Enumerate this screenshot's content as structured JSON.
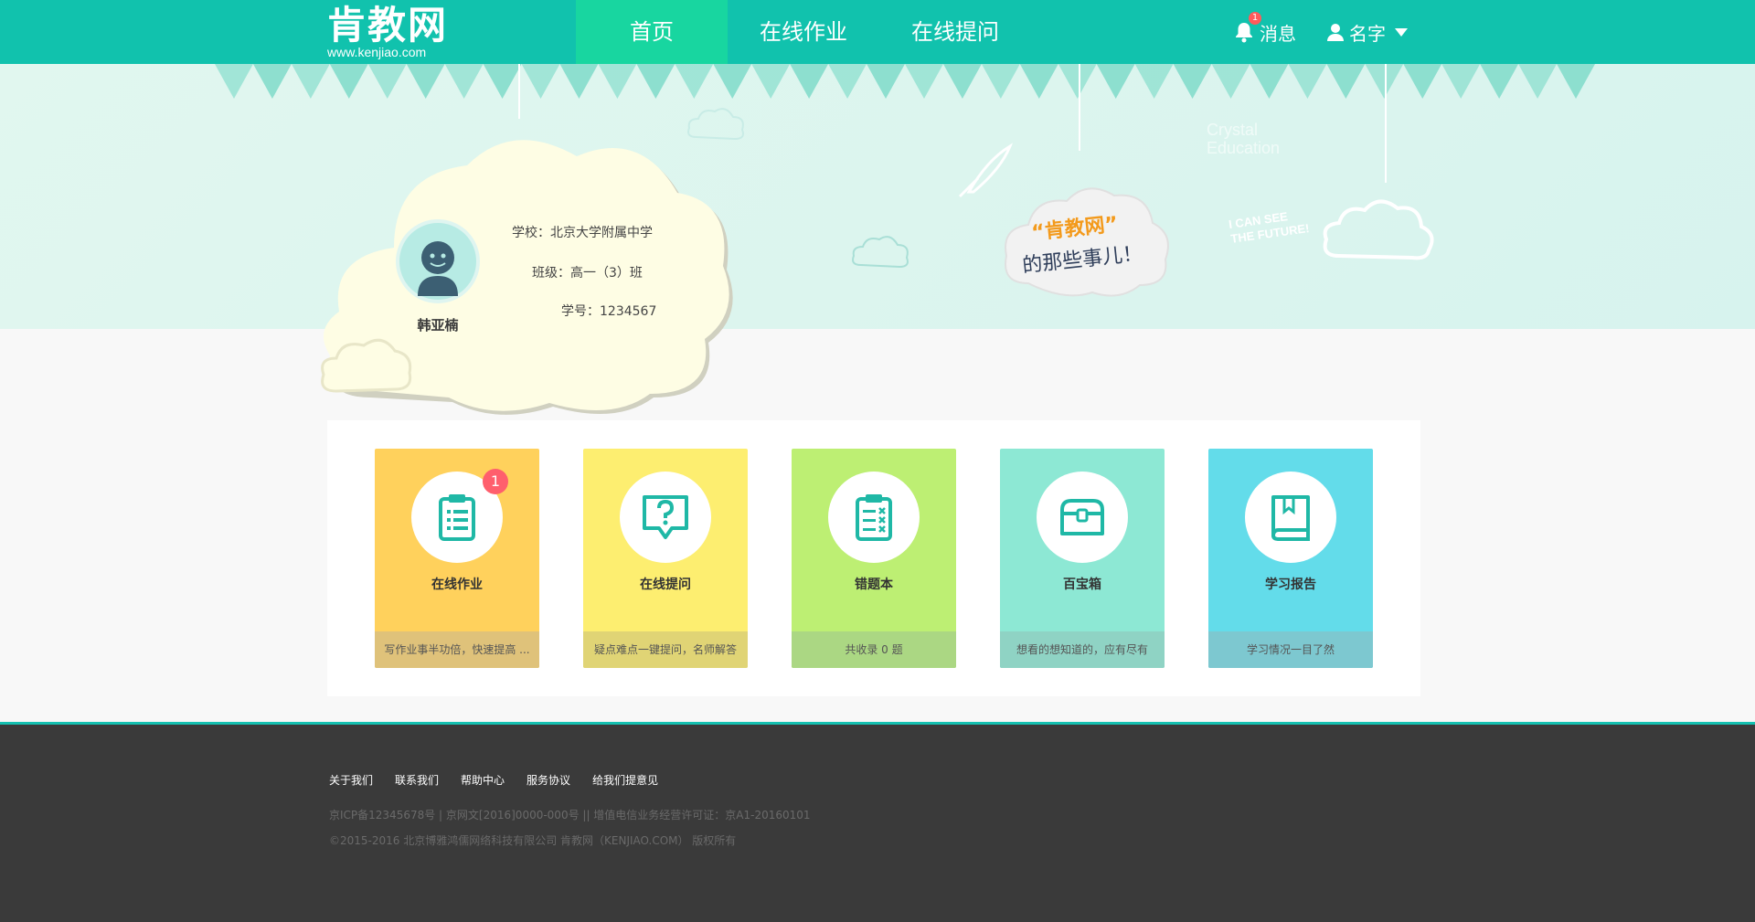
{
  "header": {
    "logo_text": "肯教网",
    "logo_domain": "www.kenjiao.com",
    "nav": [
      {
        "label": "首页",
        "active": true
      },
      {
        "label": "在线作业",
        "active": false
      },
      {
        "label": "在线提问",
        "active": false
      }
    ],
    "messages_label": "消息",
    "messages_badge": "1",
    "user_name": "名字"
  },
  "banner": {
    "slogan_brand": "“肯教网”",
    "slogan_tail": "的那些事儿！",
    "crystal_line1": "Crystal",
    "crystal_line2": "Education",
    "future_line1": "I CAN SEE",
    "future_line2": "THE FUTURE!"
  },
  "profile": {
    "name": "韩亚楠",
    "school": "学校：北京大学附属中学",
    "class": "班级：高一（3）班",
    "student_no": "学号：1234567"
  },
  "cards": [
    {
      "title": "在线作业",
      "desc": "写作业事半功倍，快速提高 ...",
      "badge": "1",
      "color": "#ffd15c",
      "foot": "#dfc27a",
      "icon": "clipboard-list-icon"
    },
    {
      "title": "在线提问",
      "desc": "疑点难点一键提问，名师解答",
      "badge": "",
      "color": "#fdee70",
      "foot": "#e0d475",
      "icon": "question-bubble-icon"
    },
    {
      "title": "错题本",
      "desc": "共收录 0 题",
      "badge": "",
      "color": "#bdef73",
      "foot": "#abd783",
      "icon": "error-list-icon"
    },
    {
      "title": "百宝箱",
      "desc": "想看的想知道的，应有尽有",
      "badge": "",
      "color": "#8de8d4",
      "foot": "#8fd3c4",
      "icon": "treasure-box-icon"
    },
    {
      "title": "学习报告",
      "desc": "学习情况一目了然",
      "badge": "",
      "color": "#63dcea",
      "foot": "#7dc8d0",
      "icon": "book-report-icon"
    }
  ],
  "footer": {
    "links": [
      "关于我们",
      "联系我们",
      "帮助中心",
      "服务协议",
      "给我们提意见"
    ],
    "icp": "京ICP备12345678号 | 京网文[2016]0000-000号 || 增值电信业务经营许可证：京A1-20160101",
    "copyright": "©2015-2016 北京博雅鸿儒网络科技有限公司  肯教网（KENJIAO.COM） 版权所有"
  },
  "colors": {
    "header_bg": "#11c2ad",
    "nav_active_bg": "#18d6a0",
    "badge_red": "#ff5f6d",
    "icon_teal": "#1fb8a6"
  }
}
